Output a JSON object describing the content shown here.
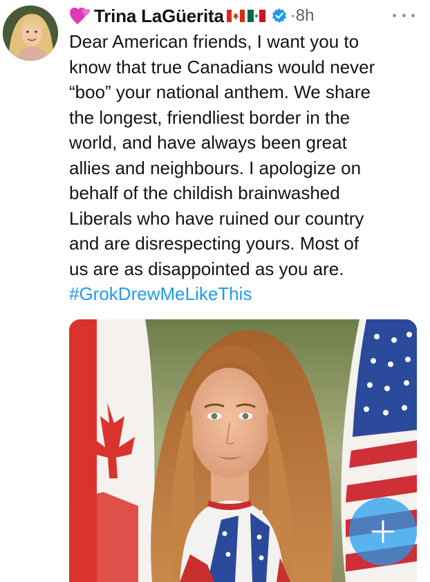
{
  "author": {
    "display_name": "Trina LaGüerita",
    "timestamp": "8h",
    "separator": "·",
    "avatar_icon": "woman-portrait-avatar",
    "name_emoji": "two-hearts-icon",
    "flags": [
      "canada-flag-icon",
      "mexico-flag-icon"
    ],
    "verified_icon": "verified-badge-icon"
  },
  "tweet": {
    "lines": [
      "Dear American friends, I want you to",
      "know that true Canadians would never",
      "“boo” your national anthem. We share",
      "the longest, friendliest border in the",
      "world, and have always been great",
      "allies and neighbours. I apologize on",
      "behalf of the childish brainwashed",
      "Liberals who have ruined our country",
      "and are disrespecting yours. Most of",
      "us are as disappointed as you are."
    ],
    "hashtag": "#GrokDrewMeLikeThis"
  },
  "media": {
    "description_icon": "ai-portrait-woman-with-canada-and-usa-flags"
  },
  "actions": {
    "more_icon": "more-options-icon",
    "compose_icon": "compose-plus-icon"
  },
  "colors": {
    "text": "#0f1419",
    "muted": "#536471",
    "link": "#1d9bf0",
    "verified": "#1d9bf0"
  }
}
